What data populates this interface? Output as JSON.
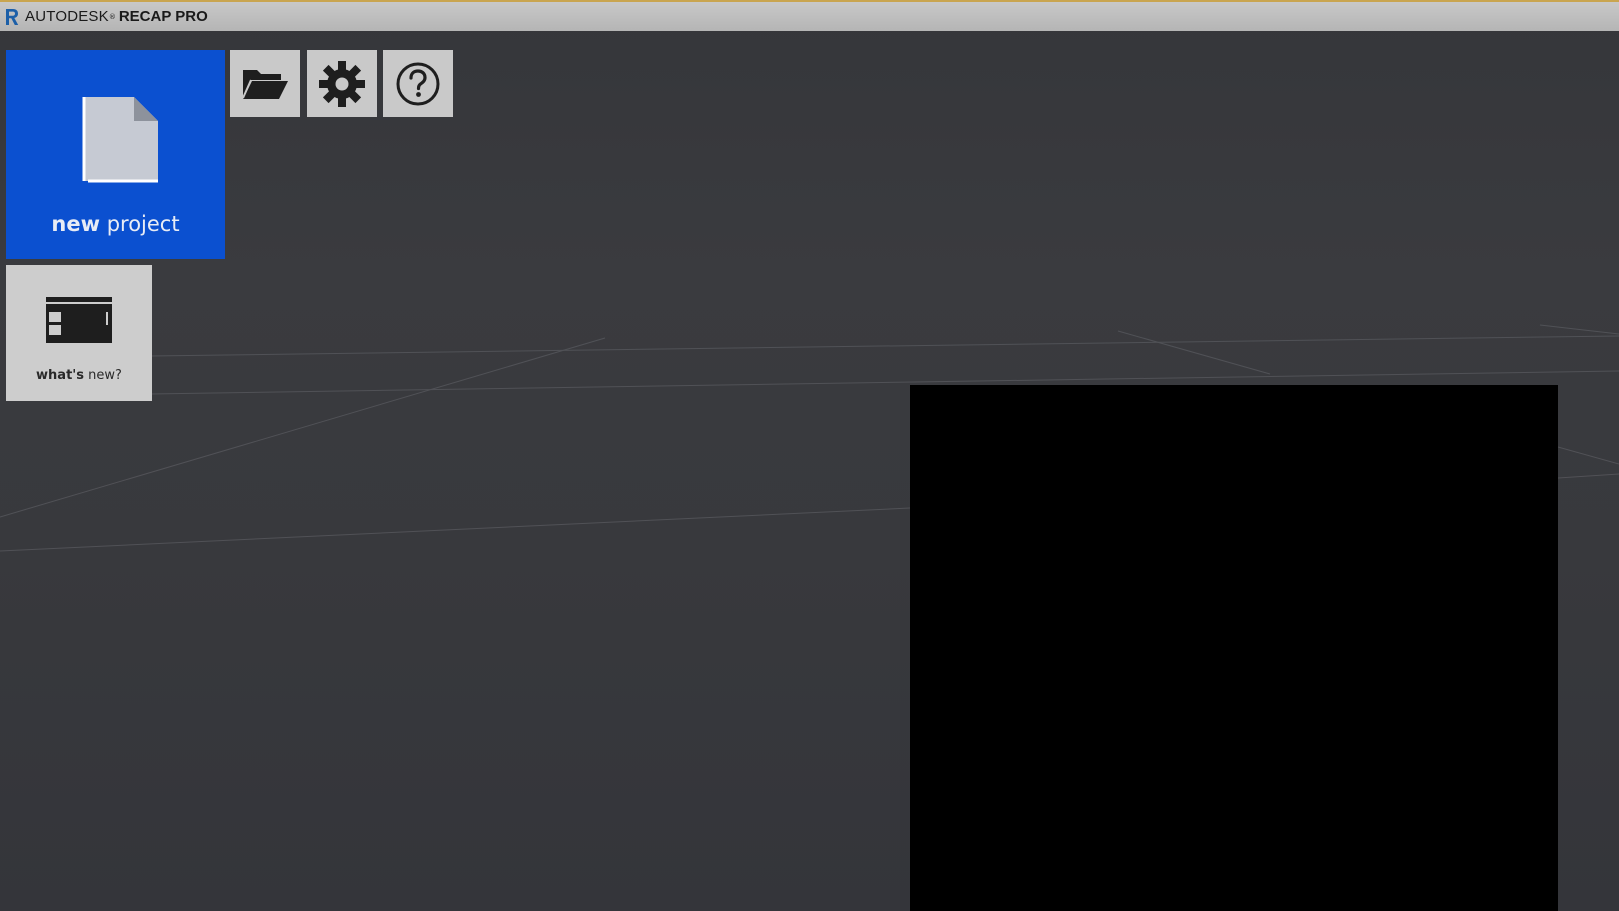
{
  "titlebar": {
    "brand": "AUTODESK",
    "brand_reg": "®",
    "product": "RECAP PRO"
  },
  "tiles": {
    "new_project": {
      "label_bold": "new",
      "label_rest": " project"
    },
    "whats_new": {
      "label_bold": "what's",
      "label_rest": " new?"
    }
  },
  "toolbar": {
    "open_icon": "folder-open-icon",
    "settings_icon": "gear-icon",
    "help_icon": "question-icon"
  },
  "colors": {
    "accent_blue": "#0b50d0",
    "tile_gray": "#c9c9c9",
    "background": "#3a3b3f",
    "titlebar_top": "#c9a550"
  }
}
